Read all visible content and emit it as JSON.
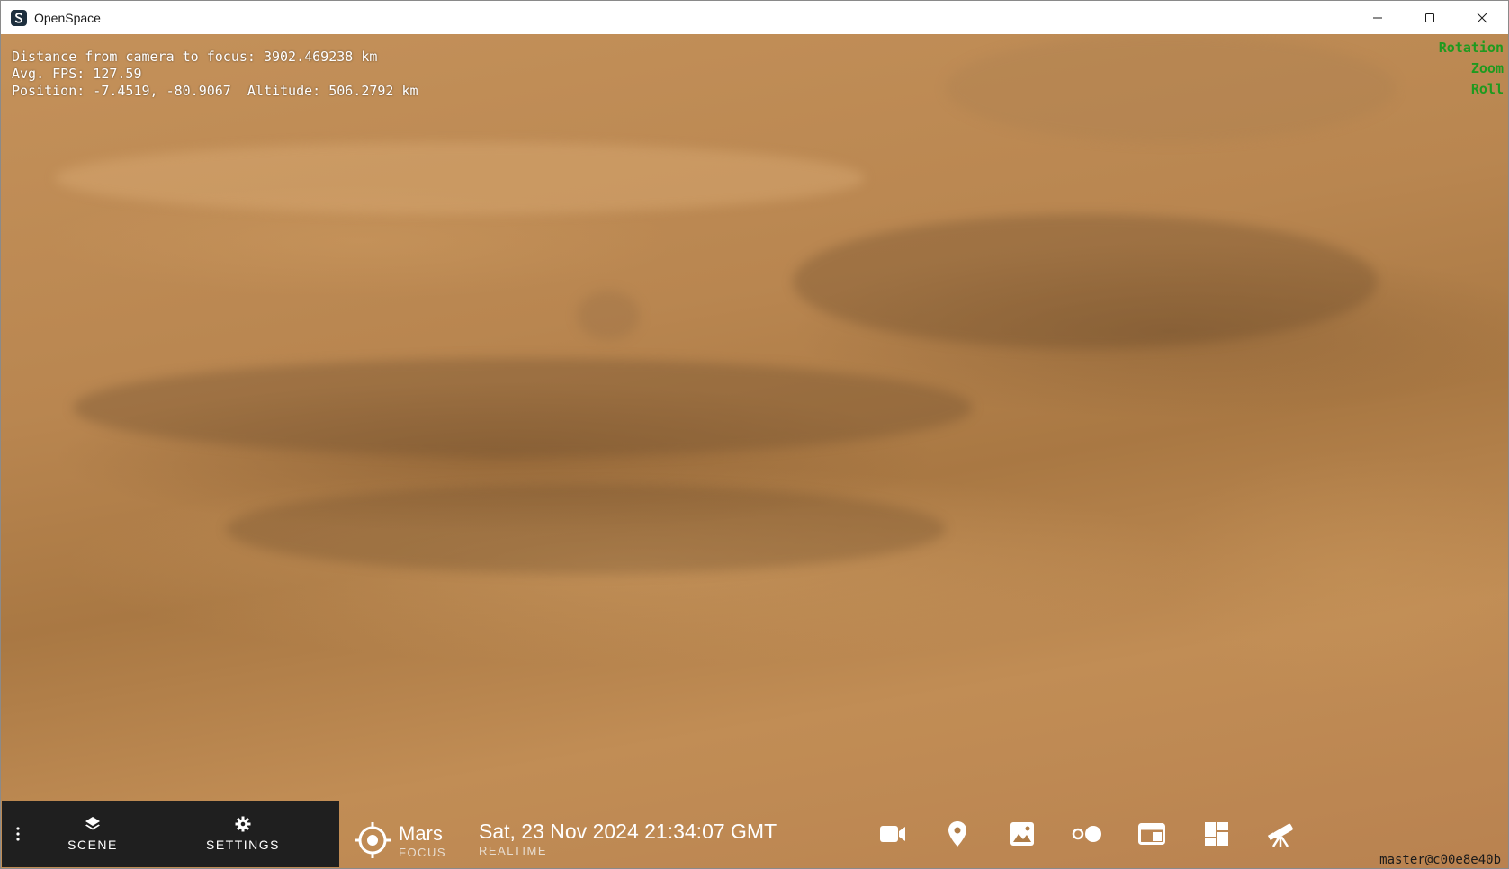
{
  "window": {
    "title": "OpenSpace"
  },
  "overlay": {
    "distance": "Distance from camera to focus: 3902.469238 km",
    "fps": "Avg. FPS: 127.59",
    "position": "Position: -7.4519, -80.9067  Altitude: 506.2792 km"
  },
  "navigation_indicators": {
    "rotation": "Rotation",
    "zoom": "Zoom",
    "roll": "Roll",
    "color": "#1f9a1f"
  },
  "version": "master@c00e8e40b",
  "panel": {
    "scene_label": "SCENE",
    "settings_label": "SETTINGS"
  },
  "focus": {
    "name": "Mars",
    "label": "FOCUS"
  },
  "time": {
    "value": "Sat, 23 Nov 2024 21:34:07 GMT",
    "label": "REALTIME"
  },
  "toolbar": {
    "icons": [
      "camera-icon",
      "location-pin-icon",
      "image-icon",
      "toggle-icon",
      "window-panel-icon",
      "dashboard-icon",
      "telescope-icon"
    ]
  }
}
